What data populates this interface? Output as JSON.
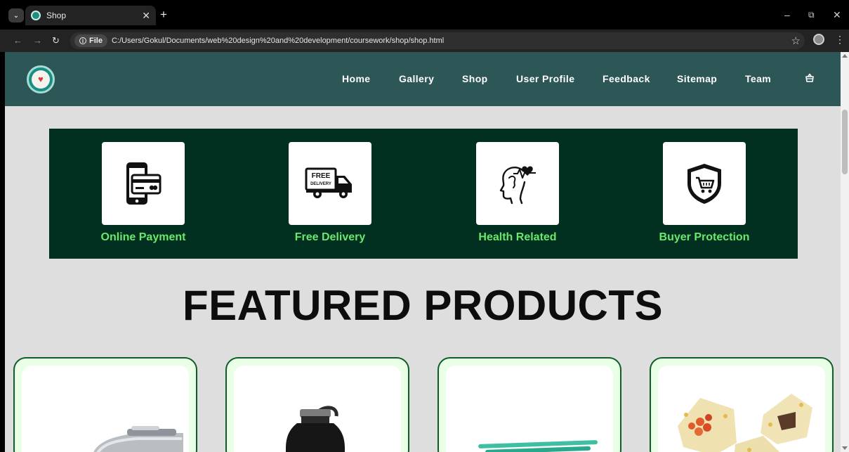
{
  "browser": {
    "tab_title": "Shop",
    "url_chip": "File",
    "url": "C:/Users/Gokul/Documents/web%20design%20and%20development/coursework/shop/shop.html",
    "window_controls": {
      "minimize": "–",
      "restore": "⧉",
      "close": "✕"
    }
  },
  "site": {
    "nav_items": [
      {
        "label": "Home"
      },
      {
        "label": "Gallery"
      },
      {
        "label": "Shop"
      },
      {
        "label": "User Profile"
      },
      {
        "label": "Feedback"
      },
      {
        "label": "Sitemap"
      },
      {
        "label": "Team"
      }
    ],
    "features": [
      {
        "label": "Online Payment",
        "icon": "mobile-payment-icon"
      },
      {
        "label": "Free Delivery",
        "icon": "delivery-truck-icon"
      },
      {
        "label": "Health Related",
        "icon": "health-head-icon"
      },
      {
        "label": "Buyer Protection",
        "icon": "shield-cart-icon"
      }
    ],
    "featured_title": "FEATURED PRODUCTS",
    "products": [
      {
        "icon": "steel-lunchbox-icon"
      },
      {
        "icon": "water-bottle-icon"
      },
      {
        "icon": "reusable-straws-icon"
      },
      {
        "icon": "beeswax-wraps-icon"
      }
    ],
    "colors": {
      "nav_bg": "#2d5657",
      "feature_band_bg": "#023020",
      "feature_label": "#6be86b",
      "page_bg": "#dedede",
      "card_border": "#0f5b2a",
      "card_bg": "#e9ffe6"
    }
  }
}
